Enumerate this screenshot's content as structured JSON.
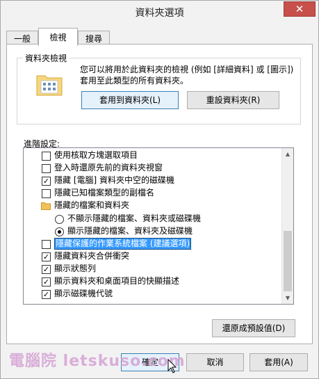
{
  "window": {
    "title": "資料夾選項",
    "close_glyph": "✕"
  },
  "tabs": [
    {
      "label": "一般"
    },
    {
      "label": "檢視"
    },
    {
      "label": "搜尋"
    }
  ],
  "folder_view": {
    "group_title": "資料夾檢視",
    "description": "您可以將用於此資料夾的檢視 (例如 [詳細資料] 或 [圖示]) 套用至此類型的所有資料夾。",
    "apply_button": "套用到資料夾(L)",
    "reset_button": "重設資料夾(R)"
  },
  "advanced": {
    "label": "進階設定:",
    "items": [
      {
        "type": "checkbox",
        "checked": false,
        "label": "使用核取方塊選取項目"
      },
      {
        "type": "checkbox",
        "checked": false,
        "label": "登入時還原先前的資料夾視窗"
      },
      {
        "type": "checkbox",
        "checked": true,
        "label": "隱藏 [電腦] 資料夾中空的磁碟機"
      },
      {
        "type": "checkbox",
        "checked": false,
        "label": "隱藏已知檔案類型的副檔名"
      },
      {
        "type": "folder",
        "label": "隱藏的檔案和資料夾"
      },
      {
        "type": "radio",
        "checked": false,
        "label": "不顯示隱藏的檔案、資料夾或磁碟機"
      },
      {
        "type": "radio",
        "checked": true,
        "label": "顯示隱藏的檔案、資料夾及磁碟機"
      },
      {
        "type": "checkbox",
        "checked": false,
        "selected": true,
        "label": "隱藏保護的作業系統檔案 (建議選項)"
      },
      {
        "type": "checkbox",
        "checked": true,
        "label": "隱藏資料夾合併衝突"
      },
      {
        "type": "checkbox",
        "checked": true,
        "label": "顯示狀態列"
      },
      {
        "type": "checkbox",
        "checked": true,
        "label": "顯示資料夾和桌面項目的快顯描述"
      },
      {
        "type": "checkbox",
        "checked": true,
        "label": "顯示磁碟機代號"
      }
    ],
    "restore_defaults_button": "還原成預設值(D)"
  },
  "footer": {
    "ok_button": "確定",
    "cancel_button": "取消",
    "apply_button": "套用(A)"
  },
  "watermark": "電腦院 letskuso.com",
  "colors": {
    "selection": "#3399ff",
    "close": "#c7504b"
  }
}
